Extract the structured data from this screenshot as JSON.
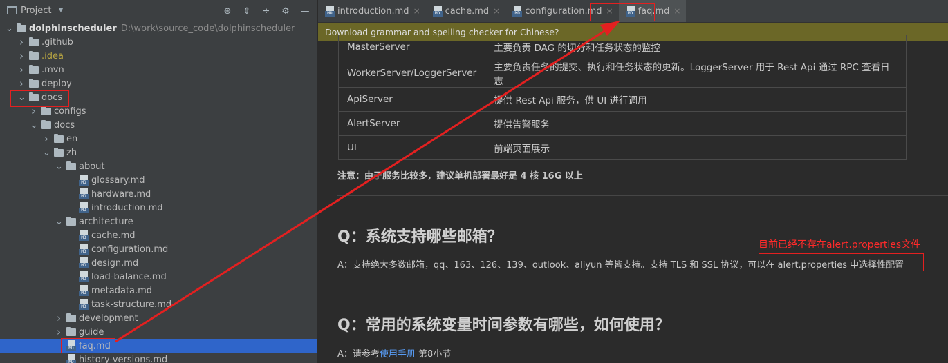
{
  "project": {
    "title": "Project",
    "tree": [
      {
        "label": "dolphinscheduler",
        "path": "D:\\work\\source_code\\dolphinscheduler",
        "depth": 0,
        "kind": "folder",
        "expanded": true,
        "bold": true
      },
      {
        "label": ".github",
        "depth": 1,
        "kind": "folder",
        "expanded": false
      },
      {
        "label": ".idea",
        "depth": 1,
        "kind": "folder",
        "expanded": false,
        "idea": true
      },
      {
        "label": ".mvn",
        "depth": 1,
        "kind": "folder",
        "expanded": false
      },
      {
        "label": "deploy",
        "depth": 1,
        "kind": "folder",
        "expanded": false
      },
      {
        "label": "docs",
        "depth": 1,
        "kind": "folder",
        "expanded": true
      },
      {
        "label": "configs",
        "depth": 2,
        "kind": "folder",
        "expanded": false
      },
      {
        "label": "docs",
        "depth": 2,
        "kind": "folder",
        "expanded": true
      },
      {
        "label": "en",
        "depth": 3,
        "kind": "folder",
        "expanded": false
      },
      {
        "label": "zh",
        "depth": 3,
        "kind": "folder",
        "expanded": true
      },
      {
        "label": "about",
        "depth": 4,
        "kind": "folder",
        "expanded": true
      },
      {
        "label": "glossary.md",
        "depth": 5,
        "kind": "md"
      },
      {
        "label": "hardware.md",
        "depth": 5,
        "kind": "md"
      },
      {
        "label": "introduction.md",
        "depth": 5,
        "kind": "md"
      },
      {
        "label": "architecture",
        "depth": 4,
        "kind": "folder",
        "expanded": true
      },
      {
        "label": "cache.md",
        "depth": 5,
        "kind": "md"
      },
      {
        "label": "configuration.md",
        "depth": 5,
        "kind": "md"
      },
      {
        "label": "design.md",
        "depth": 5,
        "kind": "md"
      },
      {
        "label": "load-balance.md",
        "depth": 5,
        "kind": "md"
      },
      {
        "label": "metadata.md",
        "depth": 5,
        "kind": "md"
      },
      {
        "label": "task-structure.md",
        "depth": 5,
        "kind": "md"
      },
      {
        "label": "development",
        "depth": 4,
        "kind": "folder",
        "expanded": false
      },
      {
        "label": "guide",
        "depth": 4,
        "kind": "folder",
        "expanded": false
      },
      {
        "label": "faq.md",
        "depth": 4,
        "kind": "md",
        "selected": true
      },
      {
        "label": "history-versions.md",
        "depth": 4,
        "kind": "md"
      }
    ]
  },
  "tabs": [
    {
      "label": "introduction.md",
      "active": false
    },
    {
      "label": "cache.md",
      "active": false
    },
    {
      "label": "configuration.md",
      "active": false
    },
    {
      "label": "faq.md",
      "active": true
    }
  ],
  "notification": "Download grammar and spelling checker for Chinese?",
  "table": [
    [
      "MasterServer",
      "主要负责 DAG 的切分和任务状态的监控"
    ],
    [
      "WorkerServer/LoggerServer",
      "主要负责任务的提交、执行和任务状态的更新。LoggerServer 用于 Rest Api 通过 RPC 查看日志"
    ],
    [
      "ApiServer",
      "提供 Rest Api 服务，供 UI 进行调用"
    ],
    [
      "AlertServer",
      "提供告警服务"
    ],
    [
      "UI",
      "前端页面展示"
    ]
  ],
  "note": "注意：由于服务比较多，建议单机部署最好是 4 核 16G 以上",
  "q1": {
    "title": "Q：系统支持哪些邮箱？",
    "answer_pre": "A：支持绝大多数邮箱，qq、163、126、139、outlook、aliyun 等皆支持。支持 TLS 和 SSL 协议，",
    "answer_boxed": "可以在 alert.properties 中选择性配置"
  },
  "q2": {
    "title": "Q：常用的系统变量时间参数有哪些，如何使用？",
    "answer_pre": "A：请参考",
    "answer_link": "使用手册",
    "answer_post": " 第8小节"
  },
  "annotation_text": "目前已经不存在alert.properties文件",
  "colors": {
    "annotation": "#e32020",
    "selection": "#2f65ca",
    "notify_bg": "#6b6727"
  }
}
